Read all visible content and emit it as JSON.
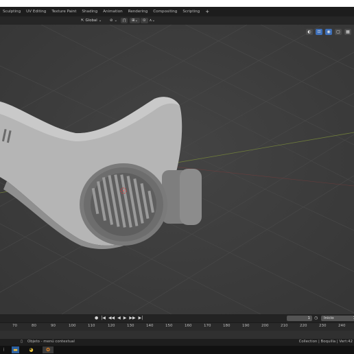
{
  "workspace_tabs": [
    "Sculpting",
    "UV Editing",
    "Texture Paint",
    "Shading",
    "Animation",
    "Rendering",
    "Compositing",
    "Scripting",
    "+"
  ],
  "header": {
    "orientation_label": "Global",
    "snap_icon": "magnet-icon",
    "proportional_icon": "proportional-edit-icon"
  },
  "viewport_overlays": {
    "icons": [
      "viewport-shading-icon",
      "overlay-icon",
      "gizmo-icon",
      "grid-icon"
    ]
  },
  "playback": {
    "controls": [
      "●",
      "|◀",
      "◀◀",
      "◀",
      "▶",
      "▶▶",
      "▶|"
    ],
    "current_frame": "1",
    "start_label": "Inicio",
    "start_frame": "1"
  },
  "timeline_ruler": {
    "ticks": [
      "70",
      "80",
      "90",
      "100",
      "110",
      "120",
      "130",
      "140",
      "150",
      "160",
      "170",
      "180",
      "190",
      "200",
      "210",
      "220",
      "230",
      "240"
    ]
  },
  "status": {
    "left_text": "Objeto - menú contextual",
    "right_text": "Collection | Boquilla | Vert:42"
  },
  "taskbar": {
    "icons": [
      "file-explorer-icon",
      "chrome-icon",
      "blender-icon"
    ]
  }
}
